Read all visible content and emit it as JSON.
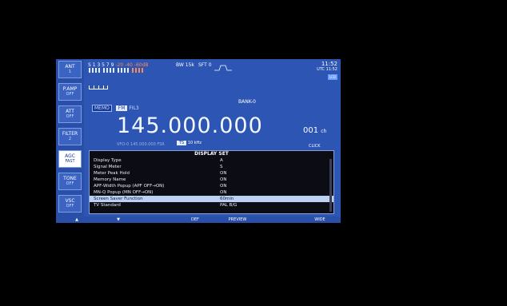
{
  "side_buttons": [
    {
      "label": "ANT",
      "value": "1"
    },
    {
      "label": "P.AMP",
      "value": "OFF"
    },
    {
      "label": "ATT",
      "value": "OFF"
    },
    {
      "label": "FILTER",
      "value": "2"
    },
    {
      "label": "AGC",
      "value": "FAST"
    },
    {
      "label": "TONE",
      "value": "OFF"
    },
    {
      "label": "VSC",
      "value": "OFF"
    }
  ],
  "meter": {
    "scale_white": "S 1  3  5  7  9",
    "scale_red": "-20  -40  -60dB",
    "bw_label": "BW 15k",
    "sft_label": "SFT 0"
  },
  "clock": {
    "local": "11:52",
    "utc": "UTC 11:52",
    "badge": "LCD"
  },
  "bank": "BANK-0",
  "mode": {
    "memo": "MEMO",
    "mode": "FM",
    "fil": "FIL3"
  },
  "frequency": "145.000.000",
  "channel": {
    "num": "001",
    "unit": "ch"
  },
  "vfo_line": "VFO-0  145.000.000  FSR",
  "ts": {
    "label": "TS",
    "value": "10 kHz"
  },
  "click": "CLICK",
  "display_set": {
    "title": "DISPLAY SET",
    "rows": [
      {
        "name": "Display Type",
        "value": "A"
      },
      {
        "name": "Signal Meter",
        "value": "S"
      },
      {
        "name": "Meter Peak Hold",
        "value": "ON"
      },
      {
        "name": "Memory Name",
        "value": "ON"
      },
      {
        "name": "APF-Width Popup (APF OFF→ON)",
        "value": "ON"
      },
      {
        "name": "MN-Q Popup (MN OFF→ON)",
        "value": "ON"
      },
      {
        "name": "Screen Saver Function",
        "value": "60min"
      },
      {
        "name": "TV Standard",
        "value": "PAL B/G"
      }
    ]
  },
  "bottom": {
    "up": "▲",
    "down": "▼",
    "def": "DEF",
    "preview": "PREVIEW",
    "wide": "WIDE"
  }
}
